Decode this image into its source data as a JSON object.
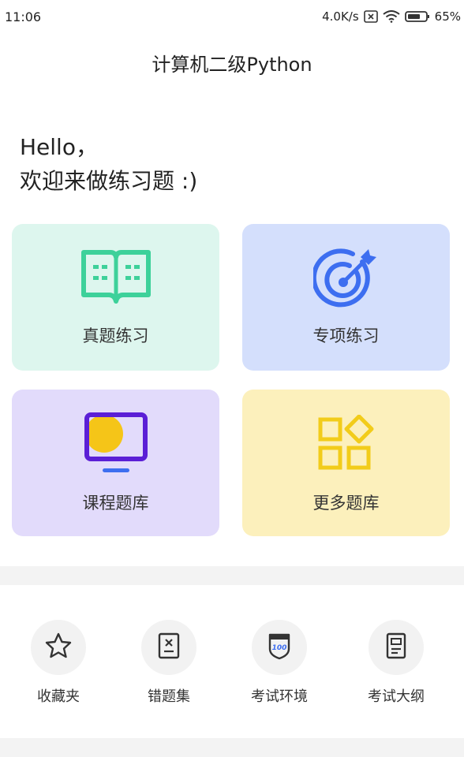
{
  "status_bar": {
    "time": "11:06",
    "speed": "4.0K/s",
    "battery": "65%"
  },
  "header": {
    "title": "计算机二级Python"
  },
  "greeting": {
    "line1": "Hello，",
    "line2": "欢迎来做练习题 :)"
  },
  "cards": [
    {
      "label": "真题练习",
      "icon": "open-book-icon",
      "color": "#ddf6ee",
      "accent": "#3dd19a"
    },
    {
      "label": "专项练习",
      "icon": "target-icon",
      "color": "#d4dffc",
      "accent": "#3d6ef0"
    },
    {
      "label": "课程题库",
      "icon": "monitor-icon",
      "color": "#e2dbfb",
      "accent": "#5b1fd6"
    },
    {
      "label": "更多题库",
      "icon": "apps-grid-icon",
      "color": "#fcf0bc",
      "accent": "#f2cc1a"
    }
  ],
  "quick_links": [
    {
      "label": "收藏夹",
      "icon": "star-icon"
    },
    {
      "label": "错题集",
      "icon": "wrong-answers-icon"
    },
    {
      "label": "考试环境",
      "icon": "exam-badge-icon"
    },
    {
      "label": "考试大纲",
      "icon": "outline-document-icon"
    }
  ]
}
